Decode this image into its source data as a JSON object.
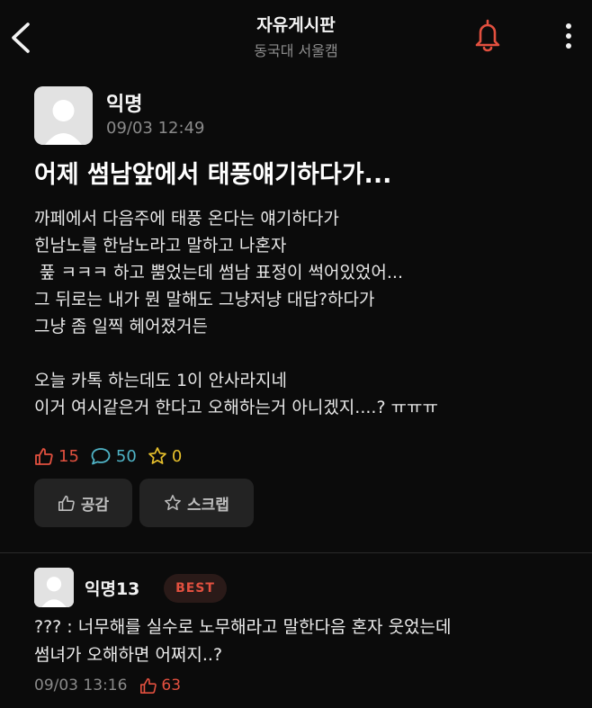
{
  "header": {
    "title": "자유게시판",
    "subtitle": "동국대 서울캠"
  },
  "post": {
    "author": "익명",
    "time": "09/03 12:49",
    "title": "어제 썸남앞에서 태풍얘기하다가...",
    "body_lines": [
      "까페에서 다음주에 태풍 온다는 얘기하다가",
      "힌남노를 한남노라고 말하고 나혼자",
      " 풒 ㅋㅋㅋ 하고 뿜었는데 썸남 표정이 썩어있었어...",
      "그 뒤로는 내가 뭔 말해도 그냥저냥 대답?하다가",
      "그냥 좀 일찍 헤어졌거든",
      "",
      "오늘 카톡 하는데도 1이 안사라지네",
      "이거 여시같은거 한다고 오해하는거 아니겠지....? ㅠㅠㅠ"
    ],
    "likes": "15",
    "comments": "50",
    "scraps": "0"
  },
  "actions": {
    "like_label": "공감",
    "scrap_label": "스크랩"
  },
  "comment": {
    "author": "익명13",
    "badge": "BEST",
    "body_lines": [
      "??? : 너무해를 실수로 노무해라고 말한다음 혼자 웃었는데",
      "썸녀가 오해하면 어쩌지..?"
    ],
    "time": "09/03 13:16",
    "likes": "63"
  },
  "colors": {
    "accent_red": "#e2503f",
    "comment_teal": "#4fb3c6",
    "scrap_yellow": "#e7c02c",
    "background": "#0b0b0b"
  },
  "icons": {
    "back": "chevron-left-icon",
    "bell": "bell-icon",
    "more": "more-vertical-icon",
    "like": "thumbs-up-icon",
    "comment": "speech-bubble-icon",
    "scrap": "star-icon"
  }
}
